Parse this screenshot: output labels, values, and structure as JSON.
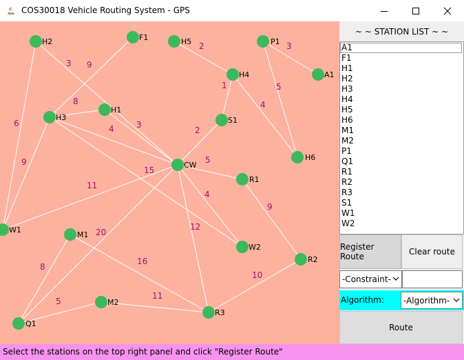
{
  "window": {
    "title": "COS30018 Vehicle Routing System - GPS"
  },
  "colors": {
    "canvas_bg": "#fdb2a0",
    "node": "#3cb95a",
    "edge": "#ffffff",
    "weight_text": "#a01070",
    "status_bg": "#f793ef",
    "algo_row_bg": "#00ffff"
  },
  "graph": {
    "nodes": [
      {
        "id": "H2",
        "label": "H2"
      },
      {
        "id": "F1",
        "label": "F1"
      },
      {
        "id": "H5",
        "label": "H5"
      },
      {
        "id": "P1",
        "label": "P1"
      },
      {
        "id": "A1",
        "label": "A1"
      },
      {
        "id": "H4",
        "label": "H4"
      },
      {
        "id": "H3",
        "label": "H3"
      },
      {
        "id": "H1",
        "label": "H1"
      },
      {
        "id": "S1",
        "label": "S1"
      },
      {
        "id": "H6",
        "label": "H6"
      },
      {
        "id": "CW",
        "label": "CW"
      },
      {
        "id": "R1",
        "label": "R1"
      },
      {
        "id": "W1",
        "label": "W1"
      },
      {
        "id": "M1",
        "label": "M1"
      },
      {
        "id": "W2",
        "label": "W2"
      },
      {
        "id": "R2",
        "label": "R2"
      },
      {
        "id": "M2",
        "label": "M2"
      },
      {
        "id": "R3",
        "label": "R3"
      },
      {
        "id": "Q1",
        "label": "Q1"
      }
    ],
    "edges": [
      {
        "from": "H5",
        "to": "H4",
        "weight": "2"
      },
      {
        "from": "P1",
        "to": "A1",
        "weight": "3"
      },
      {
        "from": "P1",
        "to": "H6",
        "weight": "5"
      },
      {
        "from": "H4",
        "to": "S1",
        "weight": "1"
      },
      {
        "from": "H4",
        "to": "H6",
        "weight": "4"
      },
      {
        "from": "H2",
        "to": "CW",
        "weight": "3"
      },
      {
        "from": "F1",
        "to": "H3",
        "weight": "9"
      },
      {
        "from": "H3",
        "to": "H1",
        "weight": "8"
      },
      {
        "from": "H3",
        "to": "CW",
        "weight": "4"
      },
      {
        "from": "H1",
        "to": "CW",
        "weight": "3"
      },
      {
        "from": "S1",
        "to": "CW",
        "weight": "2"
      },
      {
        "from": "CW",
        "to": "R1",
        "weight": "5"
      },
      {
        "from": "H2",
        "to": "W1",
        "weight": "6"
      },
      {
        "from": "H3",
        "to": "W1",
        "weight": "9"
      },
      {
        "from": "H3",
        "to": "W2",
        "weight": "15"
      },
      {
        "from": "W1",
        "to": "CW",
        "weight": "11"
      },
      {
        "from": "CW",
        "to": "W2",
        "weight": "4"
      },
      {
        "from": "R1",
        "to": "R2",
        "weight": "9"
      },
      {
        "from": "CW",
        "to": "R3",
        "weight": "12"
      },
      {
        "from": "CW",
        "to": "Q1",
        "weight": "20"
      },
      {
        "from": "M1",
        "to": "Q1",
        "weight": "8"
      },
      {
        "from": "M1",
        "to": "R3",
        "weight": "16"
      },
      {
        "from": "Q1",
        "to": "M2",
        "weight": "5"
      },
      {
        "from": "M2",
        "to": "R3",
        "weight": "11"
      },
      {
        "from": "R3",
        "to": "R2",
        "weight": "10"
      }
    ]
  },
  "panel": {
    "header": "~ ~ STATION LIST ~ ~",
    "stations": [
      "A1",
      "F1",
      "H1",
      "H2",
      "H3",
      "H4",
      "H5",
      "H6",
      "M1",
      "M2",
      "P1",
      "Q1",
      "R1",
      "R2",
      "R3",
      "S1",
      "W1",
      "W2"
    ],
    "register_label": "Register Route",
    "clear_label": "Clear route",
    "constraint_select": "-Constraint-",
    "constraint_value": "",
    "algorithm_label": "Algorithm:",
    "algorithm_select": "-Algorithm-",
    "route_label": "Route"
  },
  "status": {
    "text": "Select the stations on the top right panel and click \"Register Route\""
  }
}
